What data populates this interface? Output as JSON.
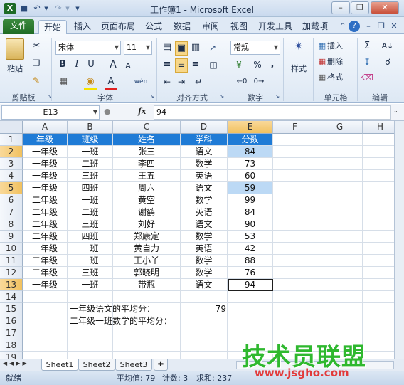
{
  "window": {
    "title": "工作簿1 - Microsoft Excel"
  },
  "tabs": [
    "文件",
    "开始",
    "插入",
    "页面布局",
    "公式",
    "数据",
    "审阅",
    "视图",
    "开发工具",
    "加载项"
  ],
  "ribbon": {
    "paste_label": "粘贴",
    "clipboard_label": "剪贴板",
    "font_name": "宋体",
    "font_size": "11",
    "bold": "B",
    "italic": "I",
    "underline": "U",
    "grow_font": "A",
    "shrink_font": "A",
    "font_color": "A",
    "phonetic": "wén",
    "font_label": "字体",
    "alignment_label": "对齐方式",
    "number_format": "常规",
    "percent": "%",
    "comma": ",",
    "number_label": "数字",
    "styles_label": "样式",
    "insert_label": "插入",
    "delete_label": "删除",
    "format_label": "格式",
    "cells_label": "单元格",
    "editing_label": "编辑"
  },
  "formula_bar": {
    "name_box": "E13",
    "fx": "fx",
    "value": "94"
  },
  "grid": {
    "columns": [
      "A",
      "B",
      "C",
      "D",
      "E",
      "F",
      "G",
      "H"
    ],
    "rows": [
      "1",
      "2",
      "3",
      "4",
      "5",
      "6",
      "7",
      "8",
      "9",
      "10",
      "11",
      "12",
      "13",
      "14",
      "15",
      "16",
      "17",
      "18",
      "19"
    ],
    "header": [
      "年级",
      "班级",
      "姓名",
      "学科",
      "分数"
    ],
    "data": [
      [
        "一年级",
        "一班",
        "张三",
        "语文",
        "84"
      ],
      [
        "一年级",
        "二班",
        "李四",
        "数学",
        "73"
      ],
      [
        "一年级",
        "三班",
        "王五",
        "英语",
        "60"
      ],
      [
        "一年级",
        "四班",
        "周六",
        "语文",
        "59"
      ],
      [
        "二年级",
        "一班",
        "黄空",
        "数学",
        "99"
      ],
      [
        "二年级",
        "二班",
        "谢鹤",
        "英语",
        "84"
      ],
      [
        "二年级",
        "三班",
        "刘好",
        "语文",
        "90"
      ],
      [
        "二年级",
        "四班",
        "郑康定",
        "数学",
        "53"
      ],
      [
        "一年级",
        "一班",
        "黄自力",
        "英语",
        "42"
      ],
      [
        "二年级",
        "一班",
        "王小丫",
        "数学",
        "88"
      ],
      [
        "二年级",
        "三班",
        "郭晓明",
        "数学",
        "76"
      ],
      [
        "一年级",
        "一班",
        "带瓶",
        "语文",
        "94"
      ]
    ],
    "summary1_label": "一年级语文的平均分：",
    "summary1_value": "79",
    "summary2_label": "二年级一班数学的平均分："
  },
  "sheets": [
    "Sheet1",
    "Sheet2",
    "Sheet3"
  ],
  "status": {
    "mode": "就绪",
    "average": "平均值: 79",
    "count": "计数: 3",
    "sum": "求和: 237"
  },
  "watermark": {
    "text": "技术员联盟",
    "url": "www.jsgho.com"
  },
  "colors": {
    "header_fill": "#1f7bd6",
    "highlight": "#bcd9f5",
    "selected_header": "#f1c15f",
    "file_tab": "#1f6b25"
  }
}
